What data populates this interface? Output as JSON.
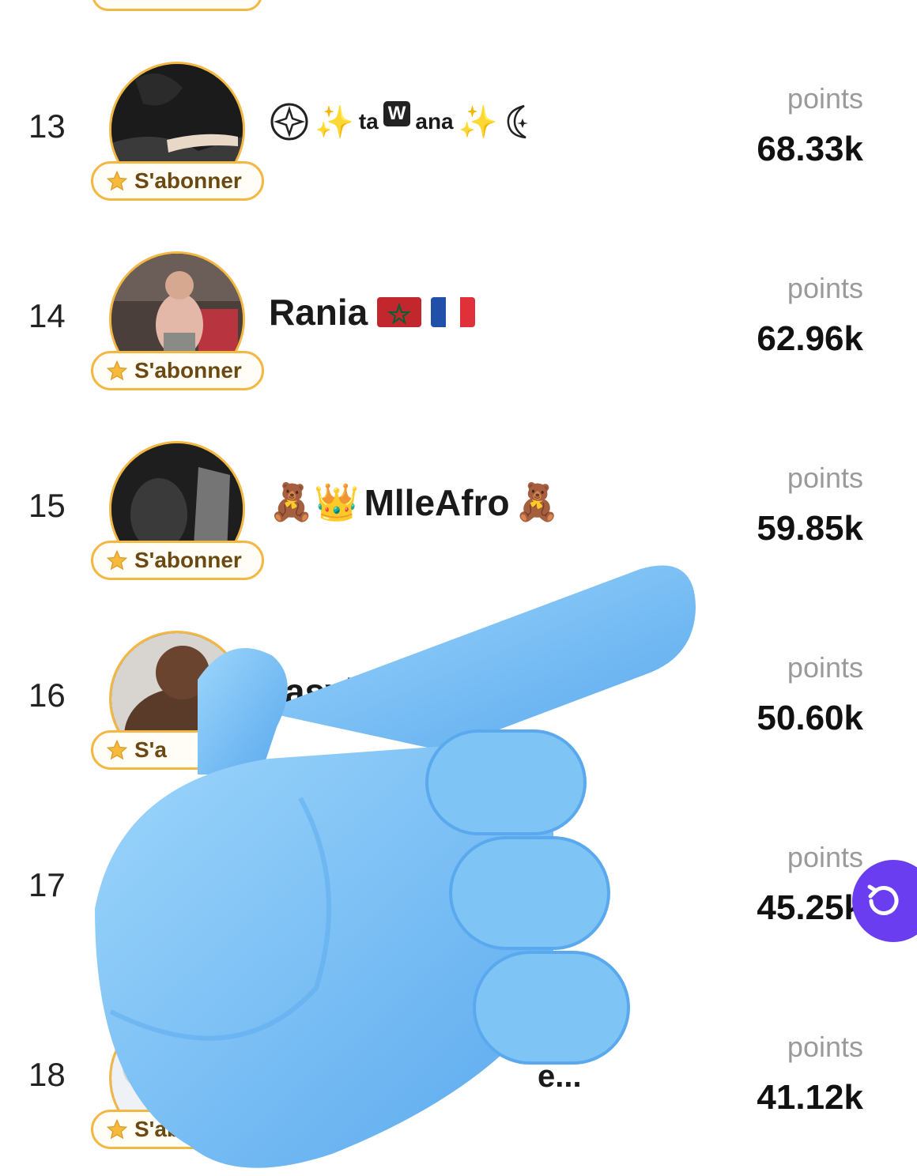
{
  "leaderboard": {
    "points_label": "points",
    "subscribe_label": "S'abonner",
    "rows": [
      {
        "rank": "13",
        "name_parts": [
          "ta",
          "W",
          "ana"
        ],
        "points": "68.33k"
      },
      {
        "rank": "14",
        "name": "Rania",
        "flags": [
          "morocco-flag",
          "france-flag"
        ],
        "points": "62.96k"
      },
      {
        "rank": "15",
        "name": "MlleAfro",
        "emoji_prefix": "🧸👑",
        "emoji_suffix": "🧸",
        "points": "59.85k"
      },
      {
        "rank": "16",
        "name_partial": "asyk l'",
        "subscribe_partial": "S'a",
        "points": "50.60k"
      },
      {
        "rank": "17",
        "points": "45.25k"
      },
      {
        "rank": "18",
        "name_partial": "e...",
        "subscribe_partial": "S'ab",
        "points": "41.12k"
      }
    ]
  },
  "overlay": {
    "icon": "pointing-hand-icon",
    "color": "#7ec4f5"
  },
  "refresh_button": {
    "icon": "refresh-icon",
    "color": "#6a3ef0"
  },
  "colors": {
    "accent_border": "#f3b744",
    "pill_text": "#6b4a12"
  }
}
